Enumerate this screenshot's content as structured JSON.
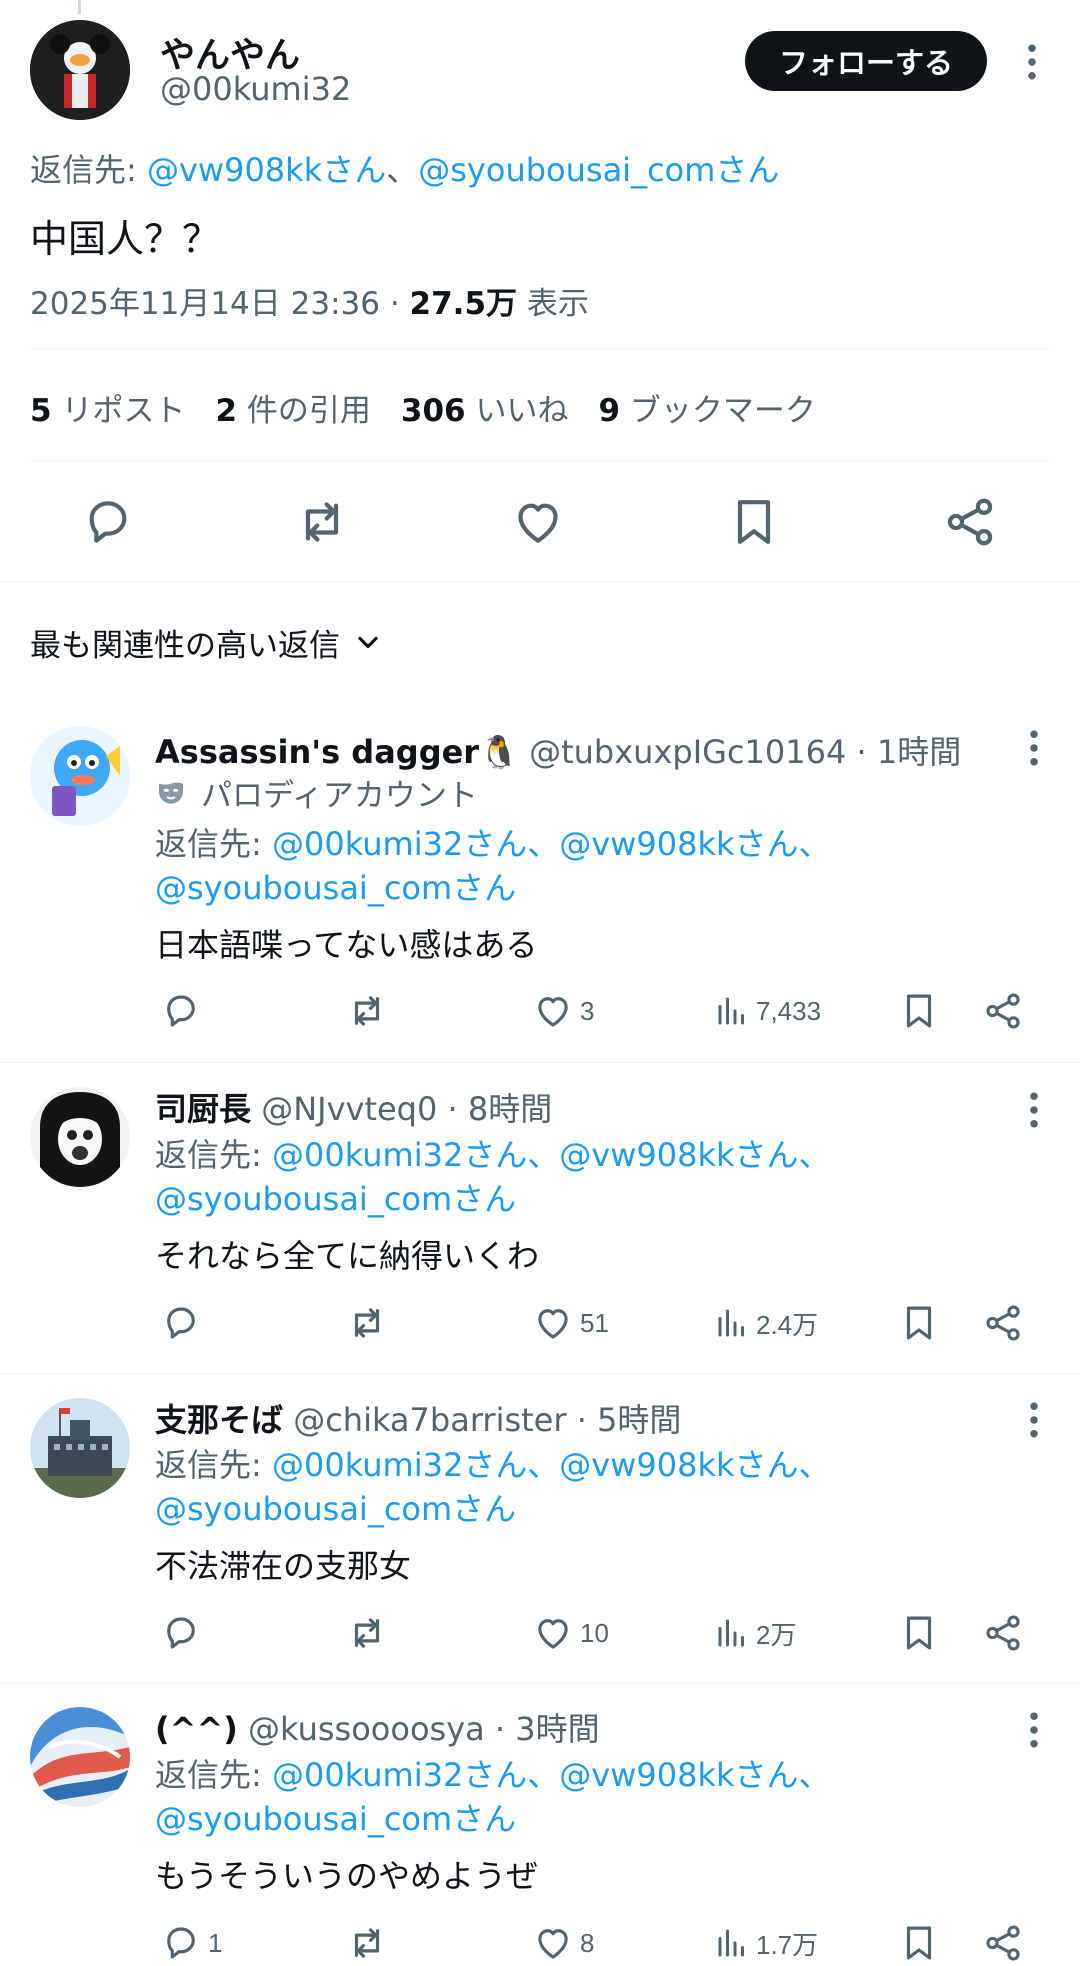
{
  "colors": {
    "accent": "#1d9bf0",
    "text": "#0f1419",
    "muted": "#536471",
    "divider": "#eff3f4",
    "follow_bg": "#0f1419"
  },
  "main_tweet": {
    "display_name": "やんやん",
    "handle": "@00kumi32",
    "follow_label": "フォローする",
    "reply_to_prefix": "返信先:",
    "reply_to_1": "@vw908kkさん",
    "reply_to_sep": "、",
    "reply_to_2": "@syoubousai_comさん",
    "text": "中国人？？",
    "timestamp": "2025年11月14日 23:36 ·",
    "views_count": "27.5万",
    "views_label": "表示",
    "stats": [
      {
        "count": "5",
        "label": "リポスト"
      },
      {
        "count": "2",
        "label": "件の引用"
      },
      {
        "count": "306",
        "label": "いいね"
      },
      {
        "count": "9",
        "label": "ブックマーク"
      }
    ]
  },
  "sort": {
    "label": "最も関連性の高い返信"
  },
  "replies": [
    {
      "name": "Assassin's dagger🐧",
      "handle": "@tubxuxpIGc10164",
      "time": "· 1時間",
      "badge": "パロディアカウント",
      "reply_prefix": "返信先:",
      "reply_handles_line1": "@00kumi32さん、@vw908kkさん、",
      "reply_handles_line2": "@syoubousai_comさん",
      "text": "日本語喋ってない感はある",
      "replies": "",
      "likes": "3",
      "views": "7,433"
    },
    {
      "name": "司厨長",
      "handle": "@NJvvteq0",
      "time": "· 8時間",
      "reply_prefix": "返信先:",
      "reply_handles_line1": "@00kumi32さん、@vw908kkさん、",
      "reply_handles_line2": "@syoubousai_comさん",
      "text": "それなら全てに納得いくわ",
      "replies": "",
      "likes": "51",
      "views": "2.4万"
    },
    {
      "name": "支那そば",
      "handle": "@chika7barrister",
      "time": "· 5時間",
      "reply_prefix": "返信先:",
      "reply_handles_line1": "@00kumi32さん、@vw908kkさん、",
      "reply_handles_line2": "@syoubousai_comさん",
      "text": "不法滞在の支那女",
      "replies": "",
      "likes": "10",
      "views": "2万"
    },
    {
      "name": "(^^)",
      "handle": "@kussoooosya",
      "time": "· 3時間",
      "reply_prefix": "返信先:",
      "reply_handles_line1": "@00kumi32さん、@vw908kkさん、",
      "reply_handles_line2": "@syoubousai_comさん",
      "text": "もうそういうのやめようぜ",
      "replies": "1",
      "likes": "8",
      "views": "1.7万"
    }
  ]
}
